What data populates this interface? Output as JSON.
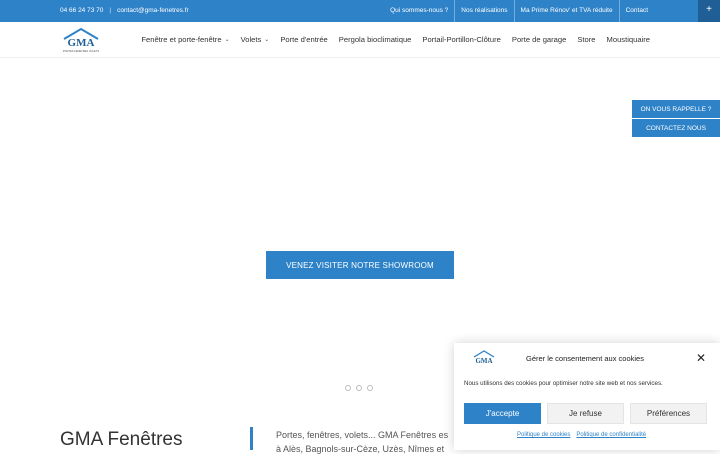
{
  "topbar": {
    "phone": "04 66 24 73 70",
    "separator": "|",
    "email": "contact@gma-fenetres.fr",
    "links": [
      "Qui sommes-nous ?",
      "Nos réalisations",
      "Ma Prime Rénov' et TVA réduite",
      "Contact"
    ],
    "corner_symbol": "+"
  },
  "header": {
    "logo_text": "GMA",
    "logo_tagline": "PORTES FENETRES VOLETS",
    "nav": [
      {
        "label": "Fenêtre et porte-fenêtre",
        "has_dropdown": true
      },
      {
        "label": "Volets",
        "has_dropdown": true
      },
      {
        "label": "Porte d'entrée",
        "has_dropdown": false
      },
      {
        "label": "Pergola bioclimatique",
        "has_dropdown": false
      },
      {
        "label": "Portail-Portillon-Clôture",
        "has_dropdown": false
      },
      {
        "label": "Porte de garage",
        "has_dropdown": false
      },
      {
        "label": "Store",
        "has_dropdown": false
      },
      {
        "label": "Moustiquaire",
        "has_dropdown": false
      }
    ],
    "dropdown_glyph": "⌄"
  },
  "hero": {
    "cta_label": "VENEZ VISITER NOTRE SHOWROOM",
    "slide_count": 3
  },
  "side_buttons": {
    "callback": "ON VOUS RAPPELLE ?",
    "contact": "CONTACTEZ NOUS"
  },
  "intro": {
    "title": "GMA Fenêtres",
    "line1": "Portes, fenêtres, volets... GMA Fenêtres es",
    "line2": "à Alès, Bagnols-sur-Cèze, Uzès, Nîmes et"
  },
  "cookie": {
    "title": "Gérer le consentement aux cookies",
    "close_symbol": "✕",
    "description": "Nous utilisons des cookies pour optimiser notre site web et nos services.",
    "accept": "J'accepte",
    "refuse": "Je refuse",
    "preferences": "Préférences",
    "cookie_policy": "Politique de cookies",
    "privacy_policy": "Politique de confidentialité"
  },
  "colors": {
    "brand": "#2e82c8",
    "brand_dark": "#1f5f96"
  }
}
